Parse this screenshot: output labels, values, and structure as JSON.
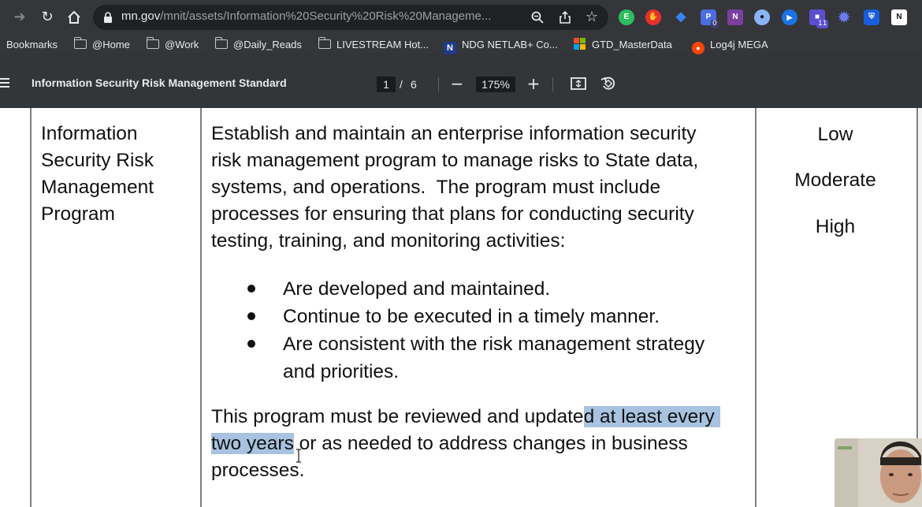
{
  "browser": {
    "url_host": "mn.gov",
    "url_path": "/mnit/assets/Information%20Security%20Risk%20Manageme...",
    "extensions": [
      {
        "name": "evernote-icon",
        "color": "#2dbe60",
        "glyph": "E"
      },
      {
        "name": "adblock-icon",
        "color": "#e8312d",
        "glyph": "✋"
      },
      {
        "name": "extension-blue-icon",
        "color": "#3b82f6",
        "glyph": "◆"
      },
      {
        "name": "extension-badge-icon",
        "color": "#4a6ee0",
        "glyph": "P",
        "badge": "0"
      },
      {
        "name": "onenote-icon",
        "color": "#7b3fa0",
        "glyph": "N"
      },
      {
        "name": "circle-extension-icon",
        "color": "#8ab4f8",
        "glyph": "●"
      },
      {
        "name": "screencast-icon",
        "color": "#1a73e8",
        "glyph": "▶"
      },
      {
        "name": "tabs-extension-icon",
        "color": "#5b4fcf",
        "glyph": "■",
        "badge": "11"
      },
      {
        "name": "gear-extension-icon",
        "color": "#6b7cf5",
        "glyph": "✹"
      },
      {
        "name": "bitwarden-icon",
        "color": "#175ddc",
        "glyph": "⛨"
      },
      {
        "name": "notion-icon",
        "color": "#ffffff",
        "glyph": "N"
      }
    ]
  },
  "bookmarks": {
    "label": "Bookmarks",
    "items": [
      {
        "label": "@Home",
        "type": "folder"
      },
      {
        "label": "@Work",
        "type": "folder"
      },
      {
        "label": "@Daily_Reads",
        "type": "folder"
      },
      {
        "label": "LIVESTREAM Hot...",
        "type": "folder"
      },
      {
        "label": "NDG NETLAB+ Co...",
        "type": "site",
        "icon": "N"
      },
      {
        "label": "GTD_MasterData",
        "type": "site",
        "icon": "ms"
      },
      {
        "label": "Log4j MEGA",
        "type": "site",
        "icon": "reddit"
      }
    ]
  },
  "pdf_toolbar": {
    "title": "Information Security Risk Management Standard",
    "current_page": "1",
    "separator": "/",
    "total_pages": "6",
    "zoom": "175%"
  },
  "document": {
    "col1_lines": [
      "Information",
      "Security Risk",
      "Management",
      "Program"
    ],
    "col2_lines": [
      "Establish and maintain an enterprise information security",
      "risk management program to manage risks to State data,",
      "systems, and operations.  The program must include",
      "processes for ensuring that plans for conducting security",
      "testing, training, and monitoring activities:"
    ],
    "bullets": [
      "Are developed and maintained.",
      "Continue to be executed in a timely manner.",
      "Are consistent with the risk management strategy and priorities."
    ],
    "para2_line1_plain": "This program must be reviewed and update",
    "para2_line1_hl": "d at least every ",
    "para2_line2_hl": "two years",
    "para2_line2_plain": " or as needed to address changes in business",
    "para2_line3": "processes.",
    "levels": [
      "Low",
      "Moderate",
      "High"
    ],
    "highlight_color": "#a8c3e0"
  }
}
